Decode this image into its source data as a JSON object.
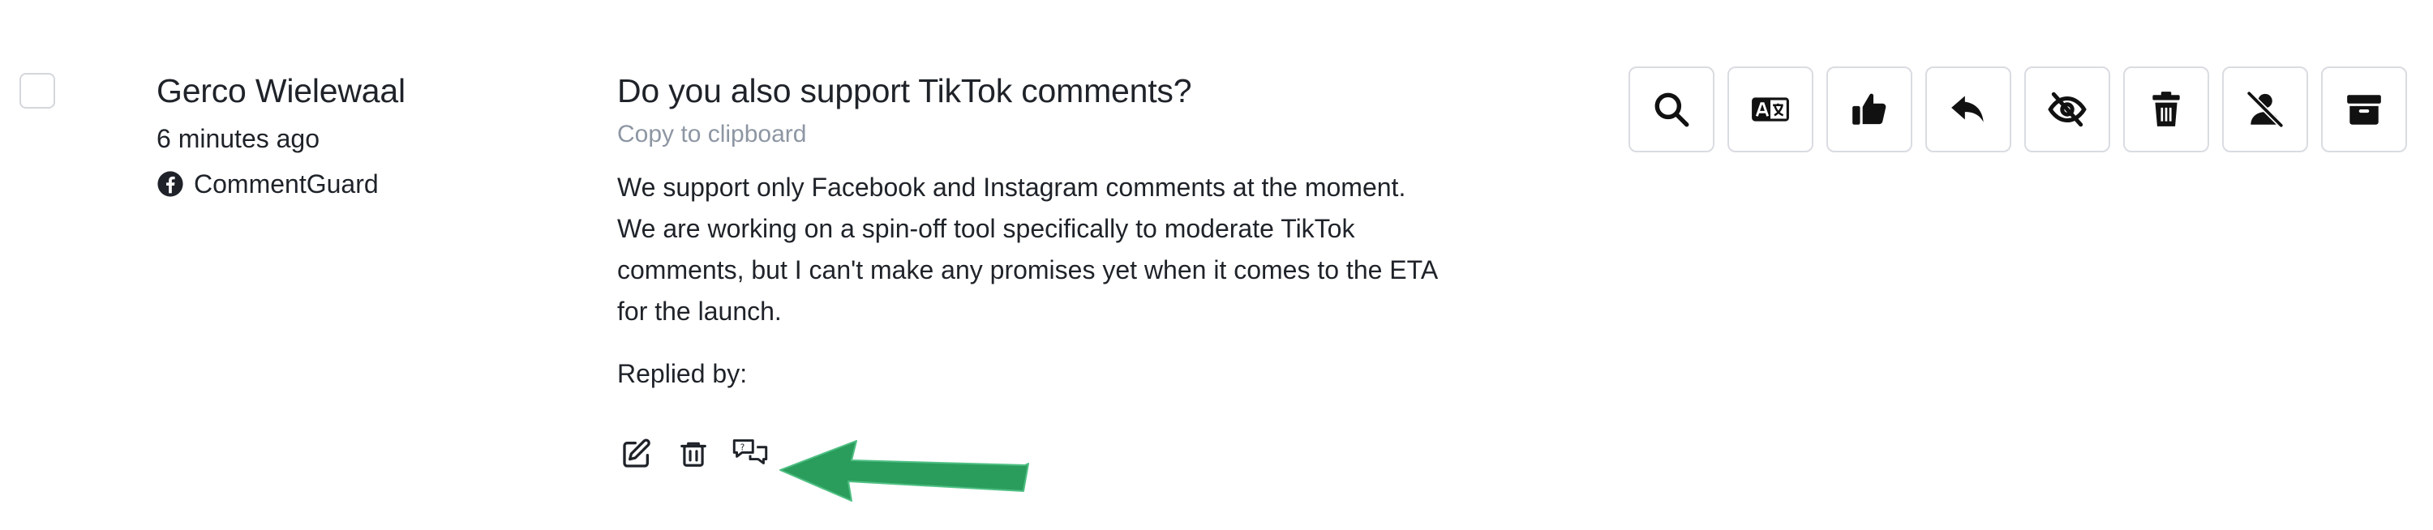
{
  "comment": {
    "author": "Gerco Wielewaal",
    "time_ago": "6 minutes ago",
    "source_page": "CommentGuard",
    "source_icon": "facebook-icon",
    "title": "Do you also support TikTok comments?",
    "copy_label": "Copy to clipboard",
    "reply_lines": [
      "We support only Facebook and Instagram comments at the moment.",
      "We are working on a spin-off tool specifically to moderate TikTok",
      "comments, but I can't make any promises yet when it comes to the ETA",
      "for the launch."
    ],
    "replied_by_label": "Replied by:"
  },
  "reply_actions": [
    {
      "icon": "edit-icon"
    },
    {
      "icon": "trash-icon"
    },
    {
      "icon": "chat-bubbles-icon"
    }
  ],
  "toolbar": [
    {
      "icon": "search-icon"
    },
    {
      "icon": "translate-icon"
    },
    {
      "icon": "thumbs-up-icon"
    },
    {
      "icon": "reply-icon"
    },
    {
      "icon": "eye-slash-icon"
    },
    {
      "icon": "trash-icon"
    },
    {
      "icon": "user-slash-icon"
    },
    {
      "icon": "archive-icon"
    }
  ],
  "colors": {
    "text": "#1f2329",
    "muted": "#8d96a3",
    "border": "#d9dce1",
    "arrow": "#2a9d5c"
  }
}
